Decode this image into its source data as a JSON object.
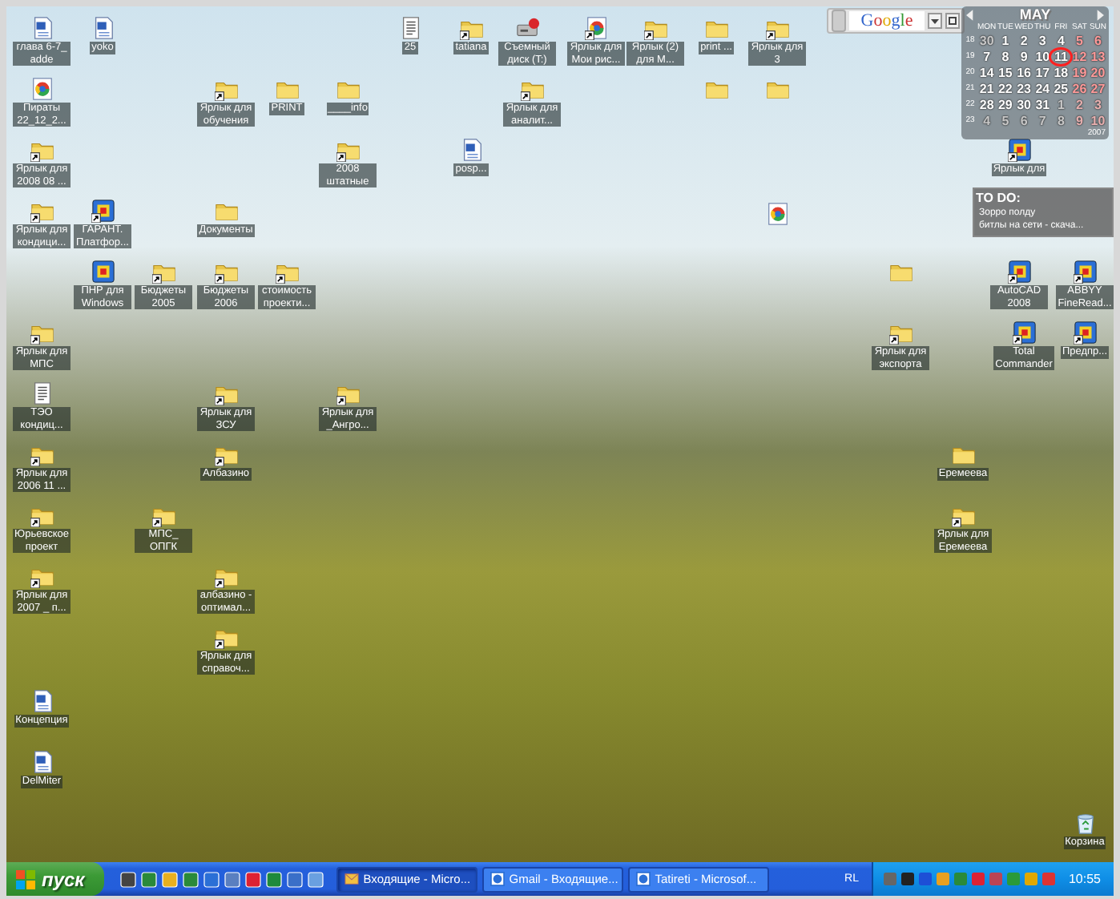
{
  "desktop_icons": [
    {
      "label": "глава 6-7_ adde",
      "kind": "doc",
      "shortcut": false
    },
    {
      "label": "yoko",
      "kind": "doc",
      "shortcut": false
    },
    {
      "label": "25",
      "kind": "text",
      "shortcut": false
    },
    {
      "label": "tatiana",
      "kind": "folder",
      "shortcut": true
    },
    {
      "label": "Съемный диск (T:)",
      "kind": "drive",
      "shortcut": false
    },
    {
      "label": "Ярлык для Мои рис...",
      "kind": "web",
      "shortcut": true
    },
    {
      "label": "Ярлык (2) для М...",
      "kind": "folder",
      "shortcut": true
    },
    {
      "label": "print ...",
      "kind": "folder",
      "shortcut": false
    },
    {
      "label": "Ярлык для 3",
      "kind": "folder",
      "shortcut": true
    },
    {
      "label": "Пираты 22_12_2...",
      "kind": "web",
      "shortcut": false
    },
    {
      "label": "Ярлык для обучения",
      "kind": "folder",
      "shortcut": true
    },
    {
      "label": "PRINT",
      "kind": "folder",
      "shortcut": false
    },
    {
      "label": "____info",
      "kind": "folder",
      "shortcut": false
    },
    {
      "label": "Ярлык для аналит...",
      "kind": "folder",
      "shortcut": true
    },
    {
      "kind": "folder",
      "shortcut": false
    },
    {
      "kind": "folder",
      "shortcut": false
    },
    {
      "label": "Ярлык для 2008 08 ...",
      "kind": "folder",
      "shortcut": true
    },
    {
      "label": "2008 штатные",
      "kind": "folder",
      "shortcut": true
    },
    {
      "label": "posp...",
      "kind": "doc",
      "shortcut": false
    },
    {
      "label": "Ярлык для",
      "kind": "app",
      "shortcut": true
    },
    {
      "label": "Ярлык для кондици...",
      "kind": "folder",
      "shortcut": true
    },
    {
      "label": "ГАРАНТ. Платфор...",
      "kind": "app",
      "shortcut": true
    },
    {
      "label": "Документы",
      "kind": "folder",
      "shortcut": false
    },
    {
      "kind": "web",
      "shortcut": false
    },
    {
      "label": "ПНР для Windows",
      "kind": "app",
      "shortcut": false
    },
    {
      "label": "Бюджеты 2005",
      "kind": "folder",
      "shortcut": true
    },
    {
      "label": "Бюджеты 2006",
      "kind": "folder",
      "shortcut": true
    },
    {
      "label": "стоимость проекти...",
      "kind": "folder",
      "shortcut": true
    },
    {
      "kind": "folder",
      "shortcut": false
    },
    {
      "label": "AutoCAD 2008",
      "kind": "app",
      "shortcut": true
    },
    {
      "label": "ABBYY FineRead...",
      "kind": "app",
      "shortcut": true
    },
    {
      "label": "Ярлык для МПС",
      "kind": "folder",
      "shortcut": true
    },
    {
      "label": "Ярлык для экспорта",
      "kind": "folder",
      "shortcut": true
    },
    {
      "label": "Total Commander",
      "kind": "app",
      "shortcut": true
    },
    {
      "label": "Предпр...",
      "kind": "app",
      "shortcut": true
    },
    {
      "label": "ТЭО кондиц...",
      "kind": "text",
      "shortcut": false
    },
    {
      "label": "Ярлык для ЗСУ",
      "kind": "folder",
      "shortcut": true
    },
    {
      "label": "Ярлык для _Ангро...",
      "kind": "folder",
      "shortcut": true
    },
    {
      "label": "Ярлык для 2006 11 ...",
      "kind": "folder",
      "shortcut": true
    },
    {
      "label": "Албазино",
      "kind": "folder",
      "shortcut": true
    },
    {
      "label": "Еремеева",
      "kind": "folder",
      "shortcut": false
    },
    {
      "label": "Юрьевское проект",
      "kind": "folder",
      "shortcut": true
    },
    {
      "label": "МПС_ ОПГК",
      "kind": "folder",
      "shortcut": true
    },
    {
      "label": "Ярлык для Еремеева",
      "kind": "folder",
      "shortcut": true
    },
    {
      "label": "Ярлык для 2007 _ п...",
      "kind": "folder",
      "shortcut": true
    },
    {
      "label": "албазино - оптимал...",
      "kind": "folder",
      "shortcut": true
    },
    {
      "label": "Ярлык для справоч...",
      "kind": "folder",
      "shortcut": true
    },
    {
      "label": "Концепция",
      "kind": "doc",
      "shortcut": false
    },
    {
      "label": "DelMiter",
      "kind": "doc",
      "shortcut": false
    },
    {
      "label": "Корзина",
      "kind": "bin",
      "shortcut": false
    }
  ],
  "search_gadget": {
    "logo": "Google"
  },
  "calendar": {
    "month": "MAY",
    "year": "2007",
    "weekdays": [
      "MON",
      "TUE",
      "WED",
      "THU",
      "FRI",
      "SAT",
      "SUN"
    ],
    "weeks": [
      {
        "number": "18",
        "days": [
          {
            "text": "30",
            "kind": "other",
            "selected": false
          },
          {
            "text": "1",
            "kind": "day",
            "selected": false
          },
          {
            "text": "2",
            "kind": "day",
            "selected": false
          },
          {
            "text": "3",
            "kind": "day",
            "selected": false
          },
          {
            "text": "4",
            "kind": "day",
            "selected": false
          },
          {
            "text": "5",
            "kind": "weekend",
            "selected": false
          },
          {
            "text": "6",
            "kind": "weekend",
            "selected": false
          }
        ]
      },
      {
        "number": "19",
        "days": [
          {
            "text": "7",
            "kind": "day",
            "selected": false
          },
          {
            "text": "8",
            "kind": "day",
            "selected": false
          },
          {
            "text": "9",
            "kind": "day",
            "selected": false
          },
          {
            "text": "10",
            "kind": "day",
            "selected": false
          },
          {
            "text": "11",
            "kind": "day",
            "selected": true
          },
          {
            "text": "12",
            "kind": "weekend",
            "selected": false
          },
          {
            "text": "13",
            "kind": "weekend",
            "selected": false
          }
        ]
      },
      {
        "number": "20",
        "days": [
          {
            "text": "14",
            "kind": "day",
            "selected": false
          },
          {
            "text": "15",
            "kind": "day",
            "selected": false
          },
          {
            "text": "16",
            "kind": "day",
            "selected": false
          },
          {
            "text": "17",
            "kind": "day",
            "selected": false
          },
          {
            "text": "18",
            "kind": "day",
            "selected": false
          },
          {
            "text": "19",
            "kind": "weekend",
            "selected": false
          },
          {
            "text": "20",
            "kind": "weekend",
            "selected": false
          }
        ]
      },
      {
        "number": "21",
        "days": [
          {
            "text": "21",
            "kind": "day",
            "selected": false
          },
          {
            "text": "22",
            "kind": "day",
            "selected": false
          },
          {
            "text": "23",
            "kind": "day",
            "selected": false
          },
          {
            "text": "24",
            "kind": "day",
            "selected": false
          },
          {
            "text": "25",
            "kind": "day",
            "selected": false
          },
          {
            "text": "26",
            "kind": "weekend",
            "selected": false
          },
          {
            "text": "27",
            "kind": "weekend",
            "selected": false
          }
        ]
      },
      {
        "number": "22",
        "days": [
          {
            "text": "28",
            "kind": "day",
            "selected": false
          },
          {
            "text": "29",
            "kind": "day",
            "selected": false
          },
          {
            "text": "30",
            "kind": "day",
            "selected": false
          },
          {
            "text": "31",
            "kind": "day",
            "selected": false
          },
          {
            "text": "1",
            "kind": "other",
            "selected": false
          },
          {
            "text": "2",
            "kind": "other-weekend",
            "selected": false
          },
          {
            "text": "3",
            "kind": "other-weekend",
            "selected": false
          }
        ]
      },
      {
        "number": "23",
        "days": [
          {
            "text": "4",
            "kind": "other",
            "selected": false
          },
          {
            "text": "5",
            "kind": "other",
            "selected": false
          },
          {
            "text": "6",
            "kind": "other",
            "selected": false
          },
          {
            "text": "7",
            "kind": "other",
            "selected": false
          },
          {
            "text": "8",
            "kind": "other",
            "selected": false
          },
          {
            "text": "9",
            "kind": "other-weekend",
            "selected": false
          },
          {
            "text": "10",
            "kind": "other-weekend",
            "selected": false
          }
        ]
      }
    ]
  },
  "todo": {
    "title": "TO DO:",
    "items": [
      "Зорро полду",
      "битлы на сети - скача..."
    ]
  },
  "taskbar": {
    "start": "пуск",
    "tasks": [
      {
        "label": "Входящие - Micro...",
        "selected": true
      },
      {
        "label": "Gmail - Входящие...",
        "selected": false
      },
      {
        "label": "Tatireti - Microsof...",
        "selected": false
      }
    ],
    "language": "RL",
    "clock": "10:55"
  }
}
